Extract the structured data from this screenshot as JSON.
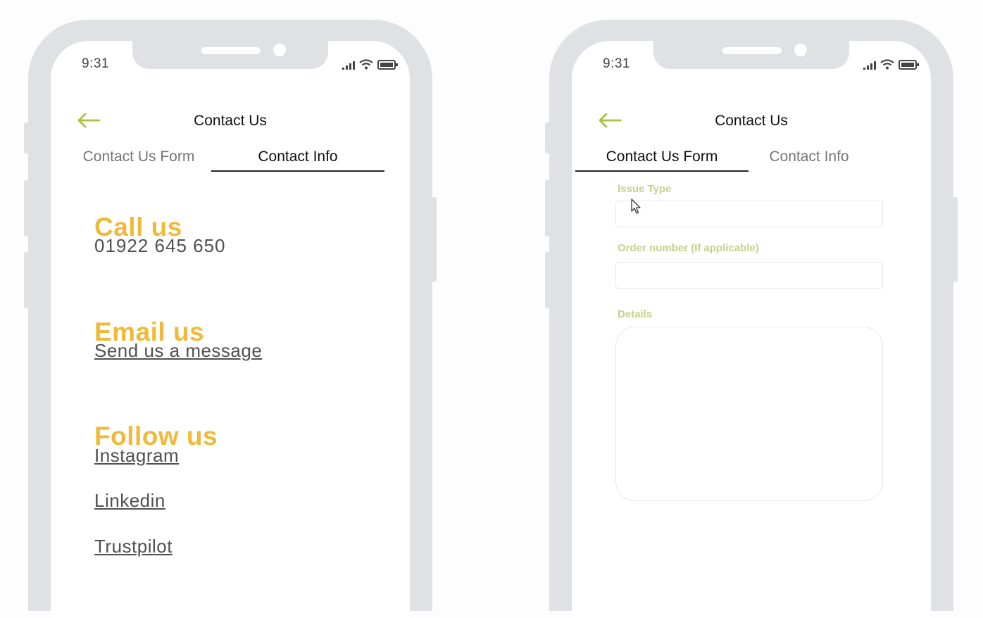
{
  "colors": {
    "accent_yellow": "#f0b93a",
    "label_green": "#c7cf8b",
    "arrow_green": "#a8c23c",
    "frame_gray": "#dfe1e5"
  },
  "status_bar": {
    "time": "9:31",
    "icons": [
      "signal-icon",
      "wifi-icon",
      "battery-icon"
    ]
  },
  "left_phone": {
    "header": {
      "back_icon": "arrow-left-icon",
      "title": "Contact Us"
    },
    "tabs": [
      {
        "label": "Contact Us Form",
        "active": false
      },
      {
        "label": "Contact Info",
        "active": true
      }
    ],
    "call": {
      "heading": "Call us",
      "phone": "01922 645 650"
    },
    "email": {
      "heading": "Email us",
      "link": "Send us a message"
    },
    "follow": {
      "heading": "Follow us",
      "links": [
        "Instagram",
        "Linkedin",
        "Trustpilot"
      ]
    }
  },
  "right_phone": {
    "header": {
      "back_icon": "arrow-left-icon",
      "title": "Contact Us"
    },
    "tabs": [
      {
        "label": "Contact Us Form",
        "active": true
      },
      {
        "label": "Contact Info",
        "active": false
      }
    ],
    "form": {
      "issue_type": {
        "label": "Issue Type",
        "value": ""
      },
      "order_number": {
        "label": "Order number (If applicable)",
        "value": ""
      },
      "details": {
        "label": "Details",
        "value": ""
      }
    }
  }
}
